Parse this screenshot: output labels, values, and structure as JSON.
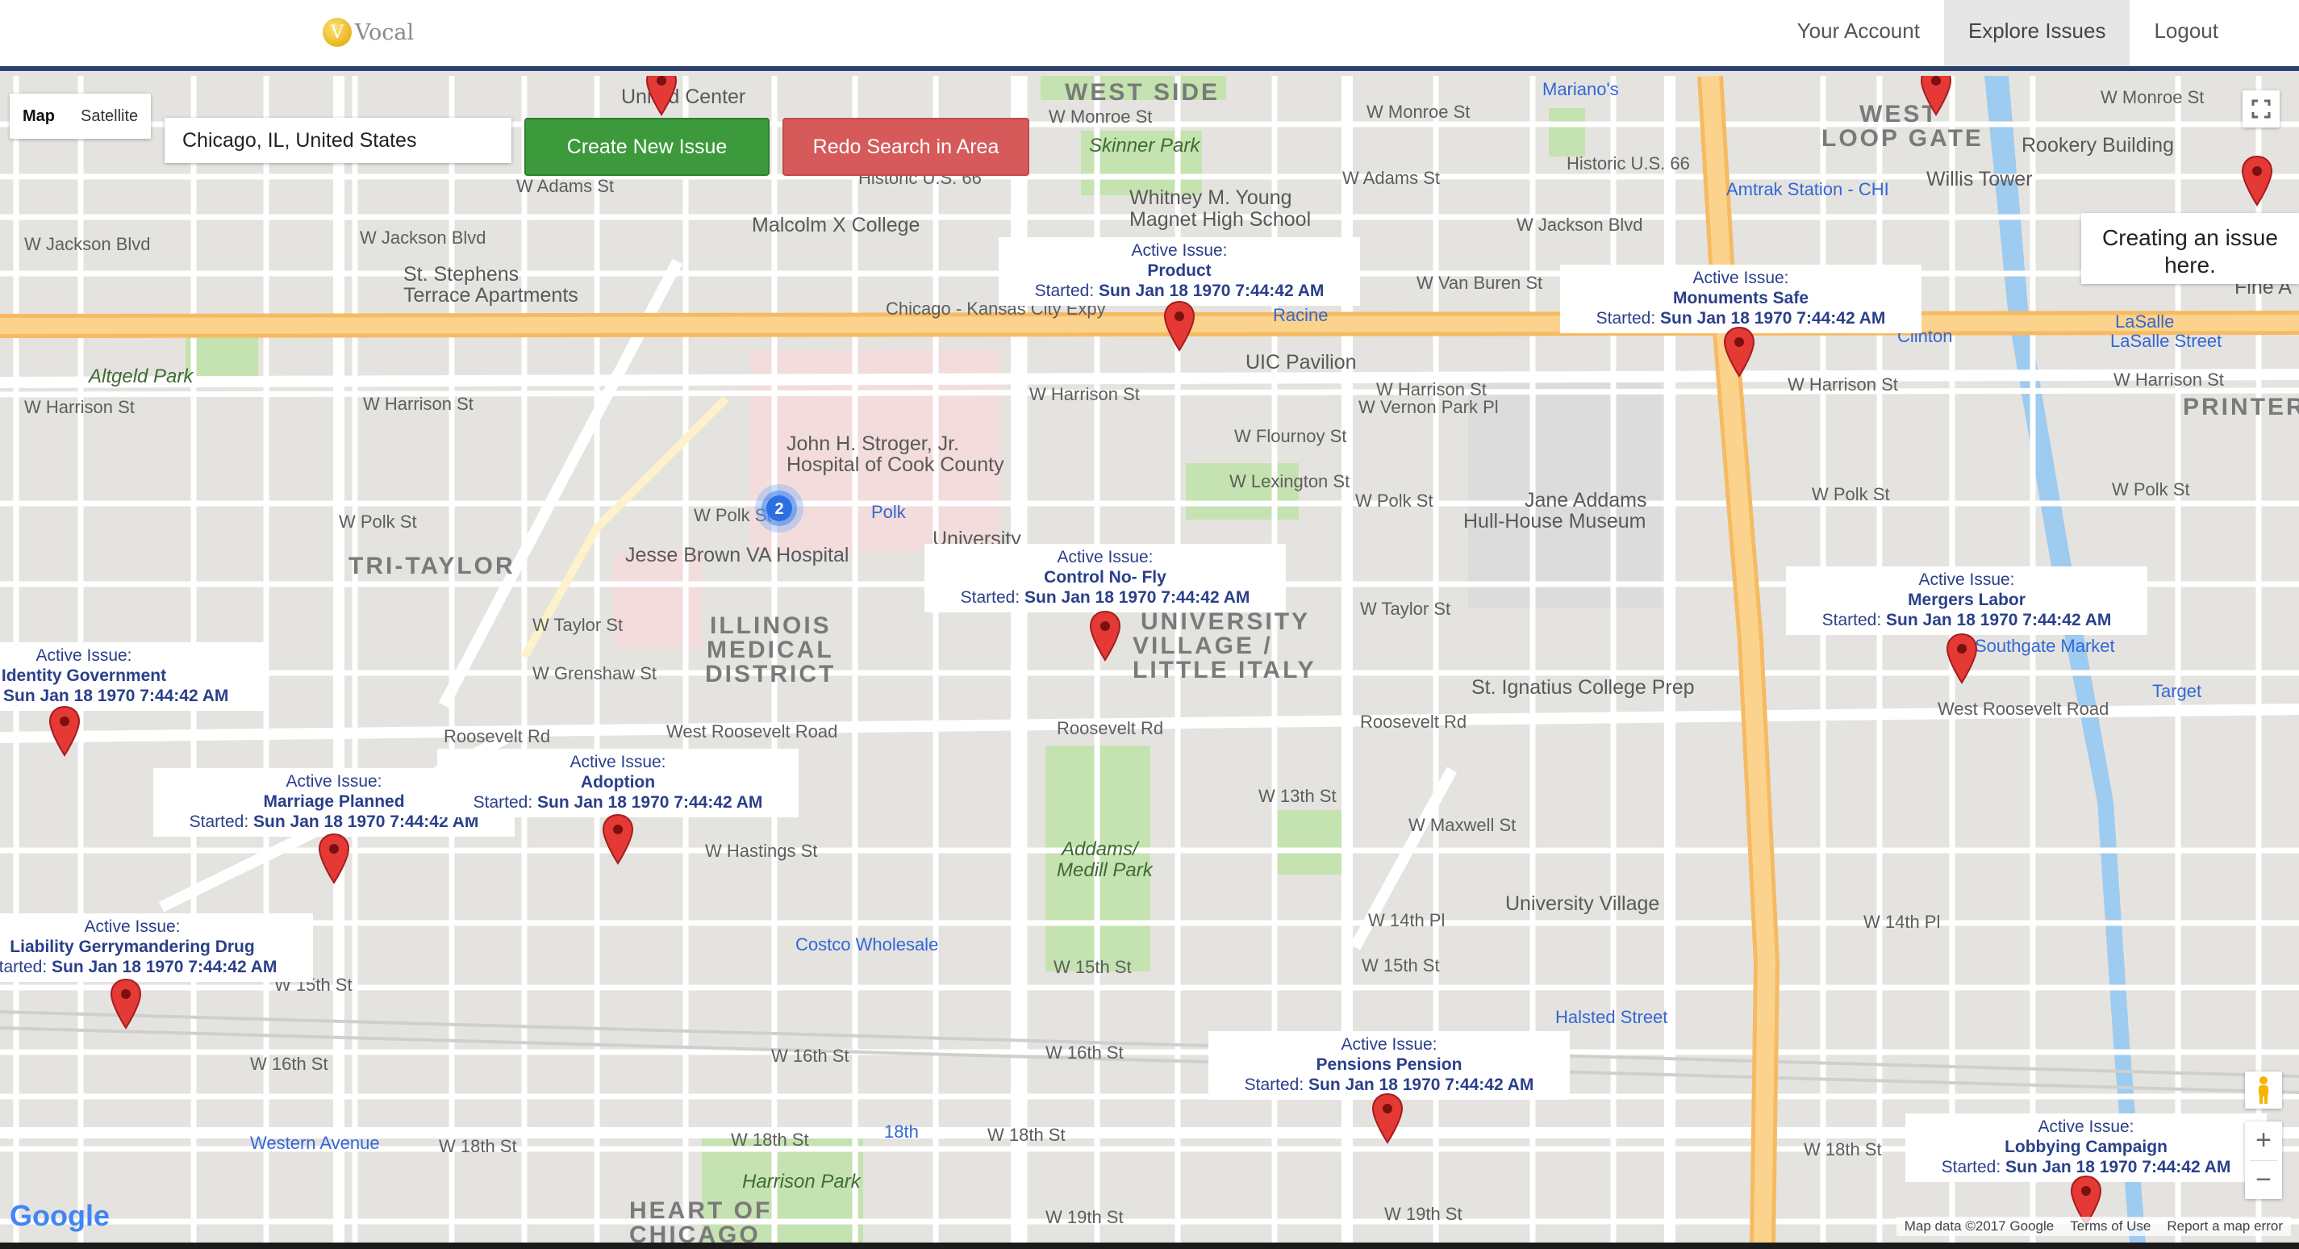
{
  "header": {
    "logo_text": "Vocal",
    "logo_glyph": "V",
    "nav": {
      "account": "Your Account",
      "explore": "Explore Issues",
      "logout": "Logout"
    }
  },
  "map_controls": {
    "map": "Map",
    "satellite": "Satellite",
    "search_value": "Chicago, IL, United States",
    "create_button": "Create New Issue",
    "redo_button": "Redo Search in Area",
    "zoom_in": "+",
    "zoom_out": "−"
  },
  "info_card": {
    "line1": "Creating an issue",
    "line2": "here."
  },
  "cluster_count": "2",
  "issue_prefix": "Active Issue:",
  "started_prefix": "Started: ",
  "started_date": "Sun Jan 18 1970 7:44:42 AM",
  "issues": [
    {
      "name": "Product"
    },
    {
      "name": "Monuments Safe"
    },
    {
      "name": "Control No- Fly"
    },
    {
      "name": "Mergers Labor"
    },
    {
      "name": "Identity Government"
    },
    {
      "name": "Marriage Planned"
    },
    {
      "name": "Adoption"
    },
    {
      "name": "Liability Gerrymandering Drug"
    },
    {
      "name": "Pensions Pension"
    },
    {
      "name": "Lobbying Campaign"
    }
  ],
  "districts": {
    "west_side": "WEST SIDE",
    "west_loop_gate": "WEST",
    "west_loop_gate2": "LOOP GATE",
    "tri_taylor": "TRI-TAYLOR",
    "illinois1": "ILLINOIS",
    "illinois2": "MEDICAL",
    "illinois3": "DISTRICT",
    "uv1": "UNIVERSITY",
    "uv2": "VILLAGE /",
    "uv3": "LITTLE ITALY",
    "heart1": "HEART OF",
    "heart2": "CHICAGO",
    "printers": "PRINTER'"
  },
  "pois": {
    "united_center": "United Center",
    "marianos": "Mariano's",
    "skinner": "Skinner Park",
    "whitney1": "Whitney M. Young",
    "whitney2": "Magnet High School",
    "malcolm": "Malcolm X College",
    "st_stephens1": "St. Stephens",
    "st_stephens2": "Terrace Apartments",
    "rookery": "Rookery Building",
    "willis": "Willis Tower",
    "amtrak": "Amtrak Station - CHI",
    "uic": "UIC Pavilion",
    "stroger1": "John H. Stroger, Jr.",
    "stroger2": "Hospital of Cook County",
    "jesse": "Jesse Brown VA Hospital",
    "university": "University",
    "jane1": "Jane Addams",
    "jane2": "Hull-House Museum",
    "southgate": "Southgate Market",
    "target": "Target",
    "ignatius": "St. Ignatius College Prep",
    "addams1": "Addams/",
    "addams2": "Medill Park",
    "costco": "Costco Wholesale",
    "uvillage": "University Village",
    "harrison": "Harrison Park",
    "altgeld": "Altgeld Park",
    "racine": "Racine",
    "clinton": "Clinton",
    "lasalle": "LaSalle",
    "lasalle_st": "LaSalle Street",
    "polk": "Polk",
    "halsted": "Halsted Street",
    "western_ave": "Western Avenue",
    "eighteenth": "18th",
    "chicago_kc": "Chicago - Kansas City Expy",
    "roosevelt": "Roosevelt Rd",
    "west_roosevelt": "West Roosevelt Road",
    "w_harrison": "W Harrison St",
    "w_polk": "W Polk St",
    "w_taylor": "W Taylor St",
    "w_adams": "W Adams St",
    "w_monroe": "W Monroe St",
    "w_jackson": "W Jackson Blvd",
    "w_vanburen": "W Van Buren St",
    "w_grenshaw": "W Grenshaw St",
    "w_hastings": "W Hastings St",
    "w_15th": "W 15th St",
    "w_16th": "W 16th St",
    "w_18th": "W 18th St",
    "w_19th": "W 19th St",
    "w_13th": "W 13th St",
    "w_14th": "W 14th Pl",
    "w_flournoy": "W Flournoy St",
    "w_lexington": "W Lexington St",
    "w_vernon": "W Vernon Park Pl",
    "w_maxwell": "W Maxwell St",
    "historic66": "Historic U.S. 66",
    "fine": "Fine A"
  },
  "attribution": {
    "map_data": "Map data ©2017 Google",
    "terms": "Terms of Use",
    "report": "Report a map error"
  },
  "google_logo": "Google"
}
